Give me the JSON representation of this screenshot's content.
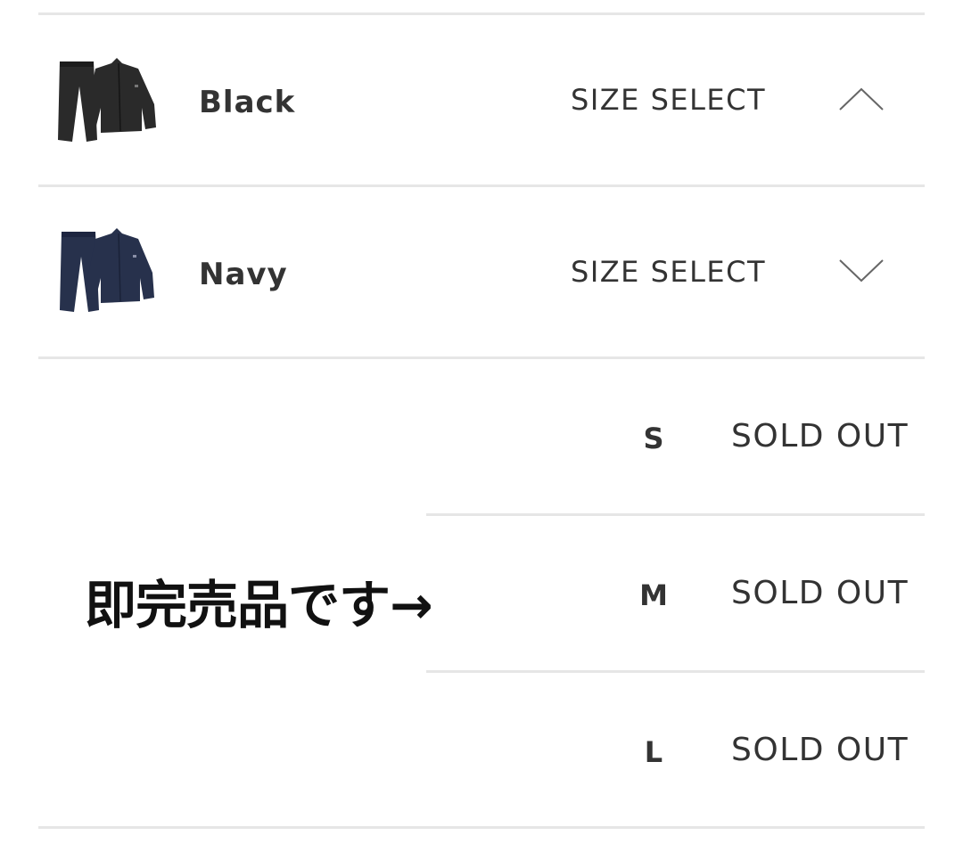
{
  "colors": [
    {
      "name": "Black",
      "size_select_label": "SIZE SELECT",
      "chevron_icon": "chevron-up-icon",
      "expanded": true,
      "swatch": "#2a2a2a"
    },
    {
      "name": "Navy",
      "size_select_label": "SIZE SELECT",
      "chevron_icon": "chevron-down-icon",
      "expanded": false,
      "swatch": "#27314c"
    }
  ],
  "sizes": [
    {
      "size": "S",
      "status": "SOLD OUT"
    },
    {
      "size": "M",
      "status": "SOLD OUT"
    },
    {
      "size": "L",
      "status": "SOLD OUT"
    }
  ],
  "note": "即完売品です→"
}
